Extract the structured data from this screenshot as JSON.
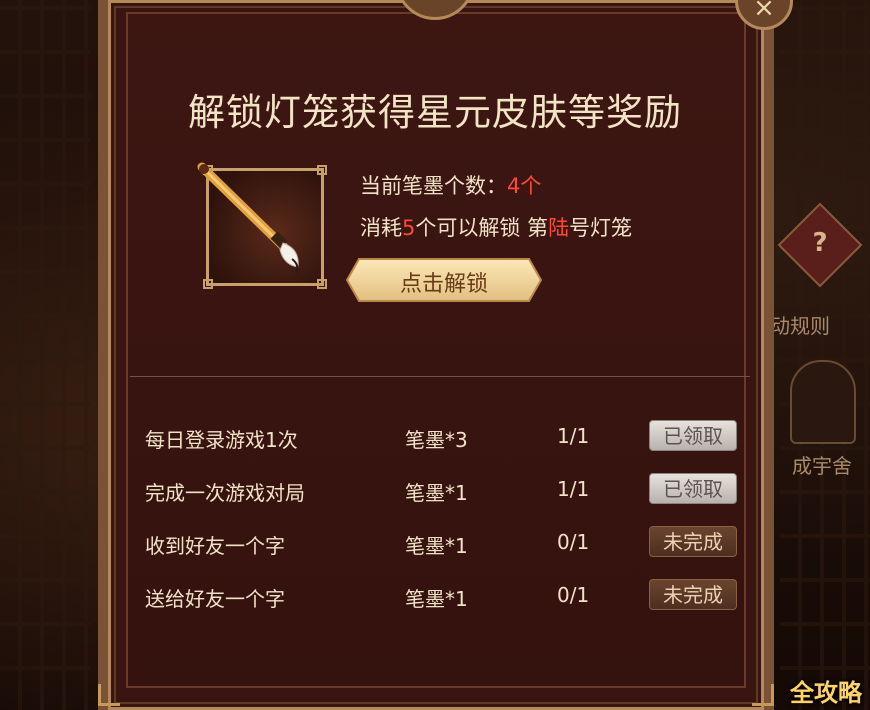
{
  "panel": {
    "title": "解锁灯笼获得星元皮肤等奖励",
    "close_icon": "×"
  },
  "unlock": {
    "current_prefix": "当前笔墨个数：",
    "current_count": "4个",
    "consume_prefix": "消耗",
    "consume_count": "5",
    "consume_mid": "个可以解锁 第",
    "lantern_number": "陆",
    "consume_suffix": "号灯笼",
    "button_label": "点击解锁",
    "highlight_color": "#ff4a3a"
  },
  "tasks": [
    {
      "name": "每日登录游戏1次",
      "reward": "笔墨*3",
      "progress": "1/1",
      "status": "已领取",
      "state": "claimed"
    },
    {
      "name": "完成一次游戏对局",
      "reward": "笔墨*1",
      "progress": "1/1",
      "status": "已领取",
      "state": "claimed"
    },
    {
      "name": "收到好友一个字",
      "reward": "笔墨*1",
      "progress": "0/1",
      "status": "未完成",
      "state": "incomplete"
    },
    {
      "name": "送给好友一个字",
      "reward": "笔墨*1",
      "progress": "0/1",
      "status": "未完成",
      "state": "incomplete"
    }
  ],
  "side": {
    "rules_icon": "?",
    "rules_label": "动规则",
    "house_label": "成宇舍"
  },
  "watermark": "全攻略"
}
